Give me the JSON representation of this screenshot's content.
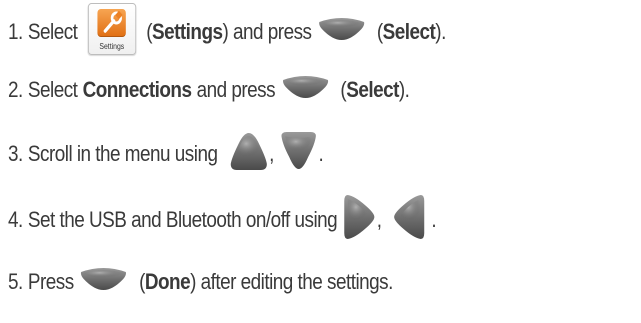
{
  "steps": [
    {
      "number": "1.",
      "text_a": "Select",
      "bold_a": "Settings",
      "text_b": ") and press",
      "bold_b": "Select"
    },
    {
      "number": "2.",
      "text_a": "Select",
      "bold_a": "Connections",
      "text_b": "and press",
      "bold_b": "Select"
    },
    {
      "number": "3.",
      "text_a": "Scroll in the menu using",
      "sep": ",",
      "end": "."
    },
    {
      "number": "4.",
      "text_a": "Set the USB and Bluetooth on/off using",
      "sep": ",",
      "end": "."
    },
    {
      "number": "5.",
      "text_a": "Press",
      "bold_a": "Done",
      "text_b": ") after editing the settings."
    }
  ],
  "settings_icon": {
    "icon": "settings-wrench-icon",
    "caption": "Settings",
    "accent": "#f08a2a"
  },
  "key_color": "#6e6e6e",
  "icons": [
    "select-key-icon",
    "up-key-icon",
    "down-key-icon",
    "right-key-icon",
    "left-key-icon"
  ]
}
